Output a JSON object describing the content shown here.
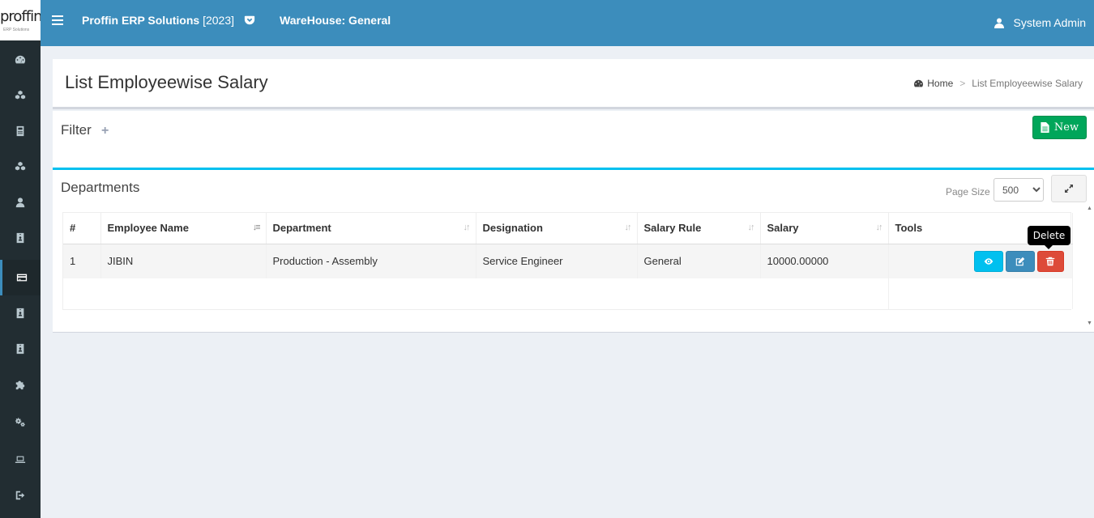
{
  "header": {
    "logo_text": "proffin",
    "logo_sub": "ERP Solutions",
    "app_name": "Proffin ERP Solutions",
    "app_year": "[2023]",
    "warehouse": "WareHouse: General",
    "user": "System Admin",
    "accent": "#3c8dbc"
  },
  "sidebar": {
    "items": [
      {
        "icon": "dashboard-icon"
      },
      {
        "icon": "cubes-icon"
      },
      {
        "icon": "calculator-icon"
      },
      {
        "icon": "cubes-icon"
      },
      {
        "icon": "user-icon"
      },
      {
        "icon": "id-card-icon"
      },
      {
        "icon": "credit-card-icon",
        "active": true
      },
      {
        "icon": "id-card-icon"
      },
      {
        "icon": "id-card-icon"
      },
      {
        "icon": "puzzle-icon"
      },
      {
        "icon": "cogs-icon"
      },
      {
        "icon": "laptop-icon"
      },
      {
        "icon": "sign-out-icon"
      }
    ]
  },
  "page": {
    "title": "List Employeewise Salary",
    "breadcrumb_home": "Home",
    "breadcrumb_current": "List Employeewise Salary"
  },
  "filter": {
    "title": "Filter",
    "new_label": "New"
  },
  "departments": {
    "title": "Departments",
    "page_size_label": "Page Size",
    "page_size_value": "500",
    "columns": [
      "#",
      "Employee Name",
      "Department",
      "Designation",
      "Salary Rule",
      "Salary",
      "Tools"
    ],
    "rows": [
      {
        "no": "1",
        "employee_name": "JIBIN",
        "department": "Production - Assembly",
        "designation": "Service Engineer",
        "salary_rule": "General",
        "salary": "10000.00000"
      }
    ],
    "tooltip": "Delete"
  }
}
